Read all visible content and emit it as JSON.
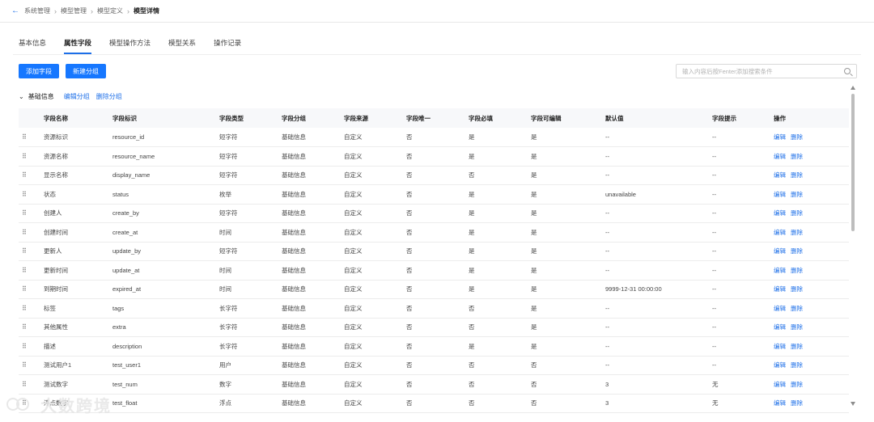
{
  "breadcrumb": {
    "items": [
      "系统管理",
      "模型管理",
      "模型定义"
    ],
    "current": "模型详情"
  },
  "tabs": [
    "基本信息",
    "属性字段",
    "模型操作方法",
    "模型关系",
    "操作记录"
  ],
  "active_tab": "属性字段",
  "toolbar": {
    "add_field": "添加字段",
    "new_group": "新建分组"
  },
  "search": {
    "placeholder": "输入内容后按Fenter添加搜索条件"
  },
  "group": {
    "title": "基础信息",
    "edit_group": "编辑分组",
    "delete_group": "删除分组"
  },
  "table": {
    "columns": [
      "字段名称",
      "字段标识",
      "字段类型",
      "字段分组",
      "字段来源",
      "字段唯一",
      "字段必填",
      "字段可编辑",
      "默认值",
      "字段提示",
      "操作"
    ],
    "actions": {
      "edit": "编辑",
      "delete": "删除"
    },
    "rows": [
      [
        "资源标识",
        "resource_id",
        "短字符",
        "基础信息",
        "自定义",
        "否",
        "是",
        "是",
        "--",
        "--"
      ],
      [
        "资源名称",
        "resource_name",
        "短字符",
        "基础信息",
        "自定义",
        "否",
        "是",
        "是",
        "--",
        "--"
      ],
      [
        "显示名称",
        "display_name",
        "短字符",
        "基础信息",
        "自定义",
        "否",
        "否",
        "是",
        "--",
        "--"
      ],
      [
        "状态",
        "status",
        "枚举",
        "基础信息",
        "自定义",
        "否",
        "是",
        "是",
        "unavailable",
        "--"
      ],
      [
        "创建人",
        "create_by",
        "短字符",
        "基础信息",
        "自定义",
        "否",
        "是",
        "是",
        "--",
        "--"
      ],
      [
        "创建时间",
        "create_at",
        "时间",
        "基础信息",
        "自定义",
        "否",
        "是",
        "是",
        "--",
        "--"
      ],
      [
        "更新人",
        "update_by",
        "短字符",
        "基础信息",
        "自定义",
        "否",
        "是",
        "是",
        "--",
        "--"
      ],
      [
        "更新时间",
        "update_at",
        "时间",
        "基础信息",
        "自定义",
        "否",
        "是",
        "是",
        "--",
        "--"
      ],
      [
        "到期时间",
        "expired_at",
        "时间",
        "基础信息",
        "自定义",
        "否",
        "是",
        "是",
        "9999-12-31 00:00:00",
        "--"
      ],
      [
        "标签",
        "tags",
        "长字符",
        "基础信息",
        "自定义",
        "否",
        "否",
        "是",
        "--",
        "--"
      ],
      [
        "其他属性",
        "extra",
        "长字符",
        "基础信息",
        "自定义",
        "否",
        "否",
        "是",
        "--",
        "--"
      ],
      [
        "描述",
        "description",
        "长字符",
        "基础信息",
        "自定义",
        "否",
        "是",
        "是",
        "--",
        "--"
      ],
      [
        "测试用户1",
        "test_user1",
        "用户",
        "基础信息",
        "自定义",
        "否",
        "否",
        "否",
        "--",
        "--"
      ],
      [
        "测试数字",
        "test_num",
        "数字",
        "基础信息",
        "自定义",
        "否",
        "否",
        "否",
        "3",
        "无"
      ],
      [
        "浮点数字",
        "test_float",
        "浮点",
        "基础信息",
        "自定义",
        "否",
        "否",
        "否",
        "3",
        "无"
      ]
    ]
  },
  "watermark": "大数跨境"
}
